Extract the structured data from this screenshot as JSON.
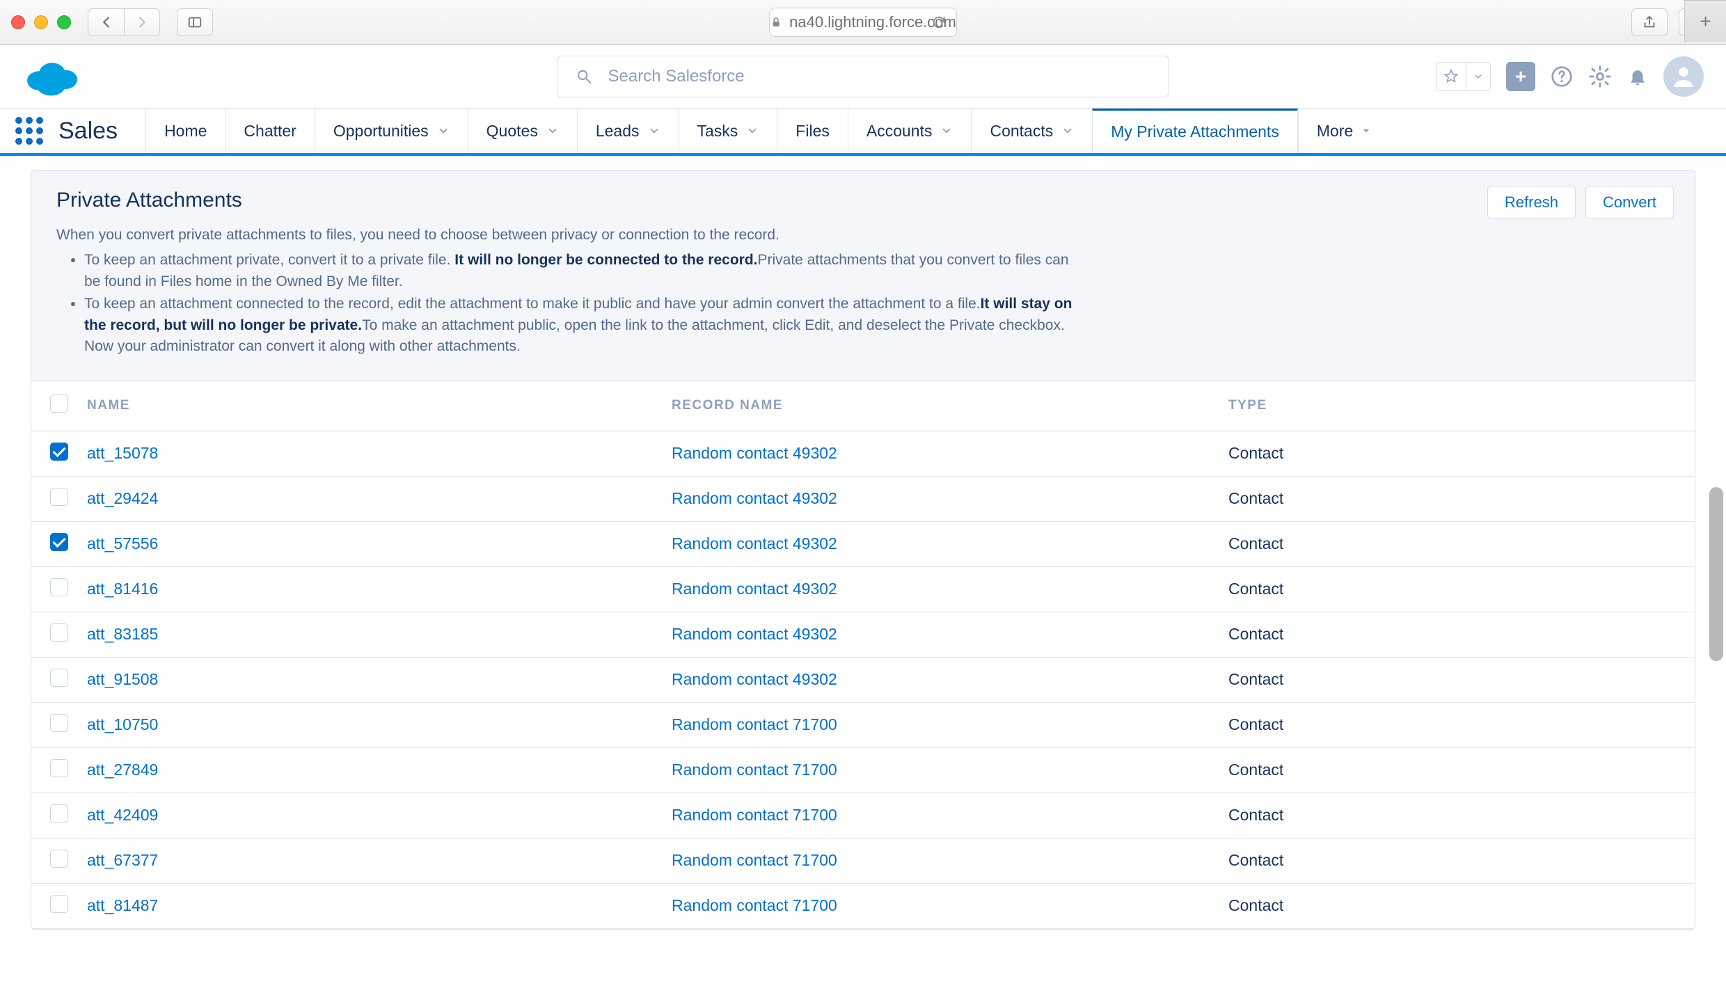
{
  "browser": {
    "url_host": "na40.lightning.force.com"
  },
  "header": {
    "search_placeholder": "Search Salesforce"
  },
  "nav": {
    "app_name": "Sales",
    "items": [
      {
        "label": "Home",
        "dropdown": false
      },
      {
        "label": "Chatter",
        "dropdown": false
      },
      {
        "label": "Opportunities",
        "dropdown": true
      },
      {
        "label": "Quotes",
        "dropdown": true
      },
      {
        "label": "Leads",
        "dropdown": true
      },
      {
        "label": "Tasks",
        "dropdown": true
      },
      {
        "label": "Files",
        "dropdown": false
      },
      {
        "label": "Accounts",
        "dropdown": true
      },
      {
        "label": "Contacts",
        "dropdown": true
      },
      {
        "label": "My Private Attachments",
        "dropdown": false,
        "active": true
      }
    ],
    "more_label": "More"
  },
  "card": {
    "title": "Private Attachments",
    "actions": {
      "refresh": "Refresh",
      "convert": "Convert"
    },
    "intro_lead": "When you convert private attachments to files, you need to choose between privacy or connection to the record.",
    "bullet1_a": "To keep an attachment private, convert it to a private file. ",
    "bullet1_bold": "It will no longer be connected to the record.",
    "bullet1_b": "Private attachments that you convert to files can be found in Files home in the Owned By Me filter.",
    "bullet2_a": "To keep an attachment connected to the record, edit the attachment to make it public and have your admin convert the attachment to a file.",
    "bullet2_bold": "It will stay on the record, but will no longer be private.",
    "bullet2_b": "To make an attachment public, open the link to the attachment, click Edit, and deselect the Private checkbox. Now your administrator can convert it along with other attachments."
  },
  "table": {
    "cols": {
      "name": "NAME",
      "record": "RECORD NAME",
      "type": "TYPE"
    },
    "rows": [
      {
        "checked": true,
        "name": "att_15078",
        "record": "Random contact 49302",
        "type": "Contact"
      },
      {
        "checked": false,
        "name": "att_29424",
        "record": "Random contact 49302",
        "type": "Contact"
      },
      {
        "checked": true,
        "name": "att_57556",
        "record": "Random contact 49302",
        "type": "Contact"
      },
      {
        "checked": false,
        "name": "att_81416",
        "record": "Random contact 49302",
        "type": "Contact"
      },
      {
        "checked": false,
        "name": "att_83185",
        "record": "Random contact 49302",
        "type": "Contact"
      },
      {
        "checked": false,
        "name": "att_91508",
        "record": "Random contact 49302",
        "type": "Contact"
      },
      {
        "checked": false,
        "name": "att_10750",
        "record": "Random contact 71700",
        "type": "Contact"
      },
      {
        "checked": false,
        "name": "att_27849",
        "record": "Random contact 71700",
        "type": "Contact"
      },
      {
        "checked": false,
        "name": "att_42409",
        "record": "Random contact 71700",
        "type": "Contact"
      },
      {
        "checked": false,
        "name": "att_67377",
        "record": "Random contact 71700",
        "type": "Contact"
      },
      {
        "checked": false,
        "name": "att_81487",
        "record": "Random contact 71700",
        "type": "Contact"
      }
    ]
  }
}
